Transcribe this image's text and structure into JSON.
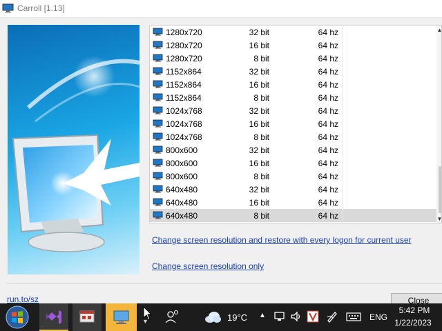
{
  "window": {
    "title": "Carroll [1.13]"
  },
  "resolutions": [
    {
      "res": "1280x720",
      "bits": "32 bit",
      "hz": "64 hz"
    },
    {
      "res": "1280x720",
      "bits": "16 bit",
      "hz": "64 hz"
    },
    {
      "res": "1280x720",
      "bits": "8 bit",
      "hz": "64 hz"
    },
    {
      "res": "1152x864",
      "bits": "32 bit",
      "hz": "64 hz"
    },
    {
      "res": "1152x864",
      "bits": "16 bit",
      "hz": "64 hz"
    },
    {
      "res": "1152x864",
      "bits": "8 bit",
      "hz": "64 hz"
    },
    {
      "res": "1024x768",
      "bits": "32 bit",
      "hz": "64 hz"
    },
    {
      "res": "1024x768",
      "bits": "16 bit",
      "hz": "64 hz"
    },
    {
      "res": "1024x768",
      "bits": "8 bit",
      "hz": "64 hz"
    },
    {
      "res": "800x600",
      "bits": "32 bit",
      "hz": "64 hz"
    },
    {
      "res": "800x600",
      "bits": "16 bit",
      "hz": "64 hz"
    },
    {
      "res": "800x600",
      "bits": "8 bit",
      "hz": "64 hz"
    },
    {
      "res": "640x480",
      "bits": "32 bit",
      "hz": "64 hz"
    },
    {
      "res": "640x480",
      "bits": "16 bit",
      "hz": "64 hz"
    },
    {
      "res": "640x480",
      "bits": "8 bit",
      "hz": "64 hz"
    }
  ],
  "selected_index": 14,
  "links": {
    "change_and_restore": "Change screen resolution and restore with every logon for current user",
    "change_only": "Change screen resolution only",
    "website": "run.to/sz"
  },
  "buttons": {
    "close": "Close"
  },
  "taskbar": {
    "apps": [
      "start-icon",
      "visual-studio-icon",
      "dialog-app-icon",
      "resolution-app-icon"
    ],
    "weather": {
      "icon": "cloud-icon",
      "temp": "19°C"
    },
    "tray_icons": [
      "network-icon",
      "volume-icon",
      "app-v-icon",
      "pen-icon",
      "keyboard-icon"
    ],
    "language": "ENG",
    "time": "5:42 PM",
    "date": "1/22/2023"
  },
  "colors": {
    "link": "#1b3fb6",
    "selected_row": "#d9d9d9",
    "taskbar": "#1c1c1c",
    "active_app": "#f3b63b"
  }
}
